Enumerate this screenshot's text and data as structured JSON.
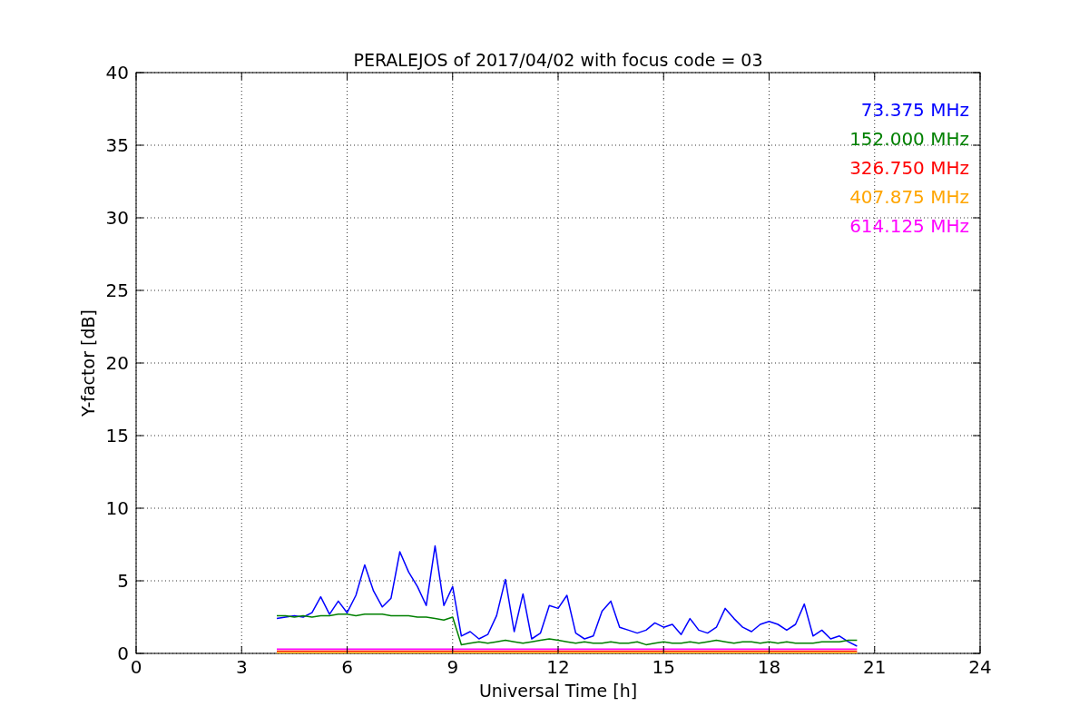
{
  "chart_data": {
    "type": "line",
    "grid": true,
    "title": "PERALEJOS of 2017/04/02 with focus code = 03",
    "xlabel": "Universal Time [h]",
    "ylabel": "Y-factor [dB]",
    "xlim": [
      0,
      24
    ],
    "ylim": [
      0,
      40
    ],
    "xticks": [
      0,
      3,
      6,
      9,
      12,
      15,
      18,
      21,
      24
    ],
    "yticks": [
      0,
      5,
      10,
      15,
      20,
      25,
      30,
      35,
      40
    ],
    "x": [
      4.0,
      4.25,
      4.5,
      4.75,
      5.0,
      5.25,
      5.5,
      5.75,
      6.0,
      6.25,
      6.5,
      6.75,
      7.0,
      7.25,
      7.5,
      7.75,
      8.0,
      8.25,
      8.5,
      8.75,
      9.0,
      9.25,
      9.5,
      9.75,
      10.0,
      10.25,
      10.5,
      10.75,
      11.0,
      11.25,
      11.5,
      11.75,
      12.0,
      12.25,
      12.5,
      12.75,
      13.0,
      13.25,
      13.5,
      13.75,
      14.0,
      14.25,
      14.5,
      14.75,
      15.0,
      15.25,
      15.5,
      15.75,
      16.0,
      16.25,
      16.5,
      16.75,
      17.0,
      17.25,
      17.5,
      17.75,
      18.0,
      18.25,
      18.5,
      18.75,
      19.0,
      19.25,
      19.5,
      19.75,
      20.0,
      20.25,
      20.5
    ],
    "series": [
      {
        "name": "73.375 MHz",
        "color": "#0000ff",
        "values": [
          2.4,
          2.5,
          2.6,
          2.5,
          2.8,
          3.9,
          2.7,
          3.6,
          2.8,
          4.0,
          6.1,
          4.3,
          3.2,
          3.8,
          7.0,
          5.6,
          4.6,
          3.3,
          7.4,
          3.3,
          4.6,
          1.2,
          1.5,
          1.0,
          1.3,
          2.6,
          5.1,
          1.5,
          4.1,
          1.0,
          1.4,
          3.3,
          3.1,
          4.0,
          1.4,
          1.0,
          1.2,
          2.9,
          3.6,
          1.8,
          1.6,
          1.4,
          1.6,
          2.1,
          1.8,
          2.0,
          1.3,
          2.4,
          1.6,
          1.4,
          1.8,
          3.1,
          2.4,
          1.8,
          1.5,
          2.0,
          2.2,
          2.0,
          1.6,
          2.0,
          3.4,
          1.2,
          1.6,
          1.0,
          1.2,
          0.8,
          0.5
        ]
      },
      {
        "name": "152.000 MHz",
        "color": "#008000",
        "values": [
          2.6,
          2.6,
          2.5,
          2.6,
          2.5,
          2.6,
          2.6,
          2.7,
          2.7,
          2.6,
          2.7,
          2.7,
          2.7,
          2.6,
          2.6,
          2.6,
          2.5,
          2.5,
          2.4,
          2.3,
          2.5,
          0.6,
          0.7,
          0.8,
          0.7,
          0.8,
          0.9,
          0.8,
          0.7,
          0.8,
          0.9,
          1.0,
          0.9,
          0.8,
          0.7,
          0.8,
          0.7,
          0.7,
          0.8,
          0.7,
          0.7,
          0.8,
          0.6,
          0.7,
          0.8,
          0.7,
          0.7,
          0.8,
          0.7,
          0.8,
          0.9,
          0.8,
          0.7,
          0.8,
          0.8,
          0.7,
          0.8,
          0.7,
          0.8,
          0.7,
          0.7,
          0.7,
          0.8,
          0.8,
          0.8,
          0.9,
          0.9
        ]
      },
      {
        "name": "326.750 MHz",
        "color": "#ff0000",
        "values": [
          0.15,
          0.15,
          0.15,
          0.15,
          0.15,
          0.15,
          0.15,
          0.15,
          0.15,
          0.15,
          0.15,
          0.15,
          0.15,
          0.15,
          0.15,
          0.15,
          0.15,
          0.15,
          0.15,
          0.15,
          0.15,
          0.15,
          0.15,
          0.15,
          0.15,
          0.15,
          0.15,
          0.15,
          0.15,
          0.15,
          0.15,
          0.15,
          0.15,
          0.15,
          0.15,
          0.15,
          0.15,
          0.15,
          0.15,
          0.15,
          0.15,
          0.15,
          0.15,
          0.15,
          0.15,
          0.15,
          0.15,
          0.15,
          0.15,
          0.15,
          0.15,
          0.15,
          0.15,
          0.15,
          0.15,
          0.15,
          0.15,
          0.15,
          0.15,
          0.15,
          0.15,
          0.15,
          0.15,
          0.15,
          0.15,
          0.15,
          0.15
        ]
      },
      {
        "name": "407.875 MHz",
        "color": "#ffa500",
        "values": [
          0.05,
          0.05,
          0.05,
          0.05,
          0.05,
          0.05,
          0.05,
          0.05,
          0.05,
          0.05,
          0.05,
          0.05,
          0.05,
          0.05,
          0.05,
          0.05,
          0.05,
          0.05,
          0.05,
          0.05,
          0.05,
          0.05,
          0.05,
          0.05,
          0.05,
          0.05,
          0.05,
          0.05,
          0.05,
          0.05,
          0.05,
          0.05,
          0.05,
          0.05,
          0.05,
          0.05,
          0.05,
          0.05,
          0.05,
          0.05,
          0.05,
          0.05,
          0.05,
          0.05,
          0.05,
          0.05,
          0.05,
          0.05,
          0.05,
          0.05,
          0.05,
          0.05,
          0.05,
          0.05,
          0.05,
          0.05,
          0.05,
          0.05,
          0.05,
          0.05,
          0.05,
          0.05,
          0.05,
          0.05,
          0.05,
          0.05,
          0.05
        ]
      },
      {
        "name": "614.125 MHz",
        "color": "#ff00ff",
        "values": [
          0.3,
          0.3,
          0.3,
          0.3,
          0.3,
          0.3,
          0.3,
          0.3,
          0.3,
          0.3,
          0.3,
          0.3,
          0.3,
          0.3,
          0.3,
          0.3,
          0.3,
          0.3,
          0.3,
          0.3,
          0.3,
          0.3,
          0.3,
          0.3,
          0.3,
          0.3,
          0.3,
          0.3,
          0.3,
          0.3,
          0.3,
          0.3,
          0.3,
          0.3,
          0.3,
          0.3,
          0.3,
          0.3,
          0.3,
          0.3,
          0.3,
          0.3,
          0.3,
          0.3,
          0.3,
          0.3,
          0.3,
          0.3,
          0.3,
          0.3,
          0.3,
          0.3,
          0.3,
          0.3,
          0.3,
          0.3,
          0.3,
          0.3,
          0.3,
          0.3,
          0.3,
          0.3,
          0.3,
          0.3,
          0.3,
          0.3,
          0.3
        ]
      }
    ]
  }
}
